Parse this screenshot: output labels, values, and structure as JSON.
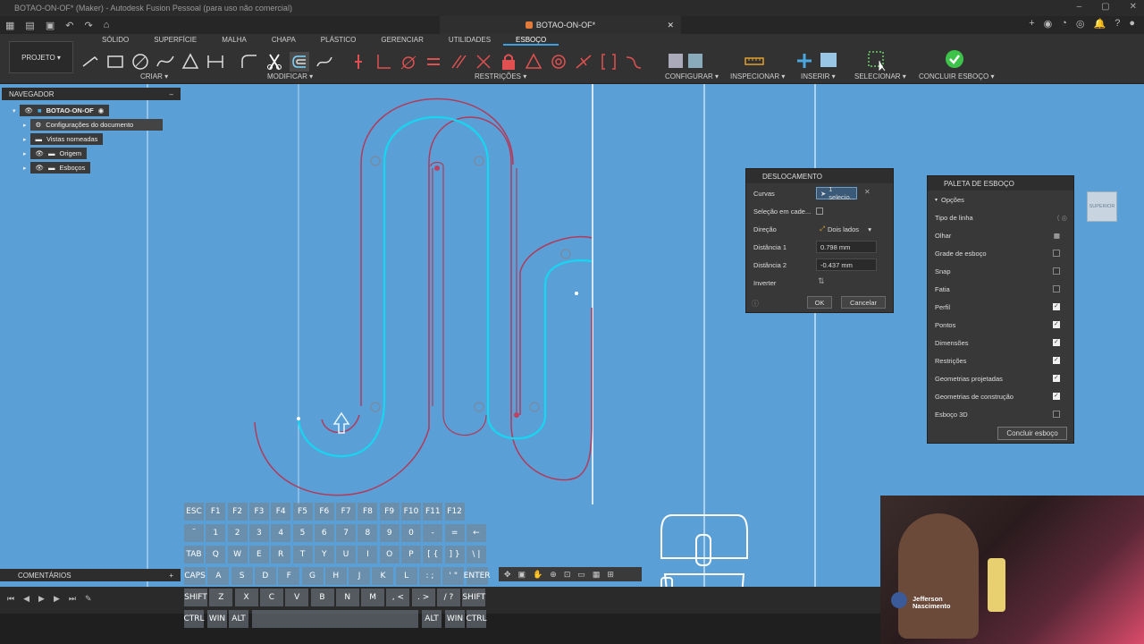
{
  "titlebar": {
    "text": "BOTAO-ON-OF* (Maker) - Autodesk Fusion Pessoal (para uso não comercial)"
  },
  "doc_tab": {
    "title": "BOTAO-ON-OF*"
  },
  "ribbon": {
    "projeto": "PROJETO ▾",
    "tabs": [
      "SÓLIDO",
      "SUPERFÍCIE",
      "MALHA",
      "CHAPA",
      "PLÁSTICO",
      "GERENCIAR",
      "UTILIDADES",
      "ESBOÇO"
    ],
    "groups": {
      "criar": "CRIAR ▾",
      "modificar": "MODIFICAR ▾",
      "restricoes": "RESTRIÇÕES ▾",
      "configurar": "CONFIGURAR ▾",
      "inspecionar": "INSPECIONAR ▾",
      "inserir": "INSERIR ▾",
      "selecionar": "SELECIONAR ▾",
      "concluir": "CONCLUIR ESBOÇO ▾"
    }
  },
  "browser": {
    "title": "NAVEGADOR",
    "items": [
      "BOTAO-ON-OF",
      "Configurações do documento",
      "Vistas nomeadas",
      "Origem",
      "Esboços"
    ]
  },
  "dialog": {
    "title": "DESLOCAMENTO",
    "curvas_label": "Curvas",
    "curvas_value": "1 selecio...",
    "selecao_label": "Seleção em cade...",
    "direcao_label": "Direção",
    "direcao_value": "Dois lados",
    "dist1_label": "Distância 1",
    "dist1_value": "0.798 mm",
    "dist2_label": "Distância 2",
    "dist2_value": "-0.437 mm",
    "inverter_label": "Inverter",
    "ok": "OK",
    "cancel": "Cancelar"
  },
  "palette": {
    "title": "PALETA DE ESBOÇO",
    "section": "Opções",
    "rows": [
      {
        "label": "Tipo de linha",
        "type": "icon"
      },
      {
        "label": "Olhar",
        "type": "icon"
      },
      {
        "label": "Grade de esboço",
        "checked": false
      },
      {
        "label": "Snap",
        "checked": false
      },
      {
        "label": "Fatia",
        "checked": false
      },
      {
        "label": "Perfil",
        "checked": true
      },
      {
        "label": "Pontos",
        "checked": true
      },
      {
        "label": "Dimensões",
        "checked": true
      },
      {
        "label": "Restrições",
        "checked": true
      },
      {
        "label": "Geometrias projetadas",
        "checked": true
      },
      {
        "label": "Geometrias de construção",
        "checked": true
      },
      {
        "label": "Esboço 3D",
        "checked": false
      }
    ],
    "finish_button": "Concluir esboço"
  },
  "comments": {
    "label": "COMENTÁRIOS",
    "plus": "+"
  },
  "viewcube": {
    "label": "SUPERIOR"
  },
  "webcam": {
    "name_line1": "Jefferson",
    "name_line2": "Nascimento"
  },
  "keyboard": {
    "rows": [
      [
        "ESC",
        "F1",
        "F2",
        "F3",
        "F4",
        "F5",
        "F6",
        "F7",
        "F8",
        "F9",
        "F10",
        "F11",
        "F12"
      ],
      [
        "˜",
        "1",
        "2",
        "3",
        "4",
        "5",
        "6",
        "7",
        "8",
        "9",
        "0",
        "-",
        "=",
        "←"
      ],
      [
        "TAB",
        "Q",
        "W",
        "E",
        "R",
        "T",
        "Y",
        "U",
        "I",
        "O",
        "P",
        "[ {",
        "] }",
        "\\ |"
      ],
      [
        "CAPS",
        "A",
        "S",
        "D",
        "F",
        "G",
        "H",
        "J",
        "K",
        "L",
        ": ;",
        "' \"",
        "ENTER"
      ],
      [
        "SHIFT",
        "Z",
        "X",
        "C",
        "V",
        "B",
        "N",
        "M",
        ", <",
        ". >",
        "/ ?",
        "SHIFT"
      ],
      [
        "CTRL",
        "WIN",
        "ALT",
        "ALT",
        "WIN",
        "CTRL"
      ]
    ]
  },
  "colors": {
    "canvas": "#5a9fd6",
    "cyan_curve": "#17d6f2",
    "red_curve": "#b23a5a",
    "accent": "#3aa0e0"
  }
}
